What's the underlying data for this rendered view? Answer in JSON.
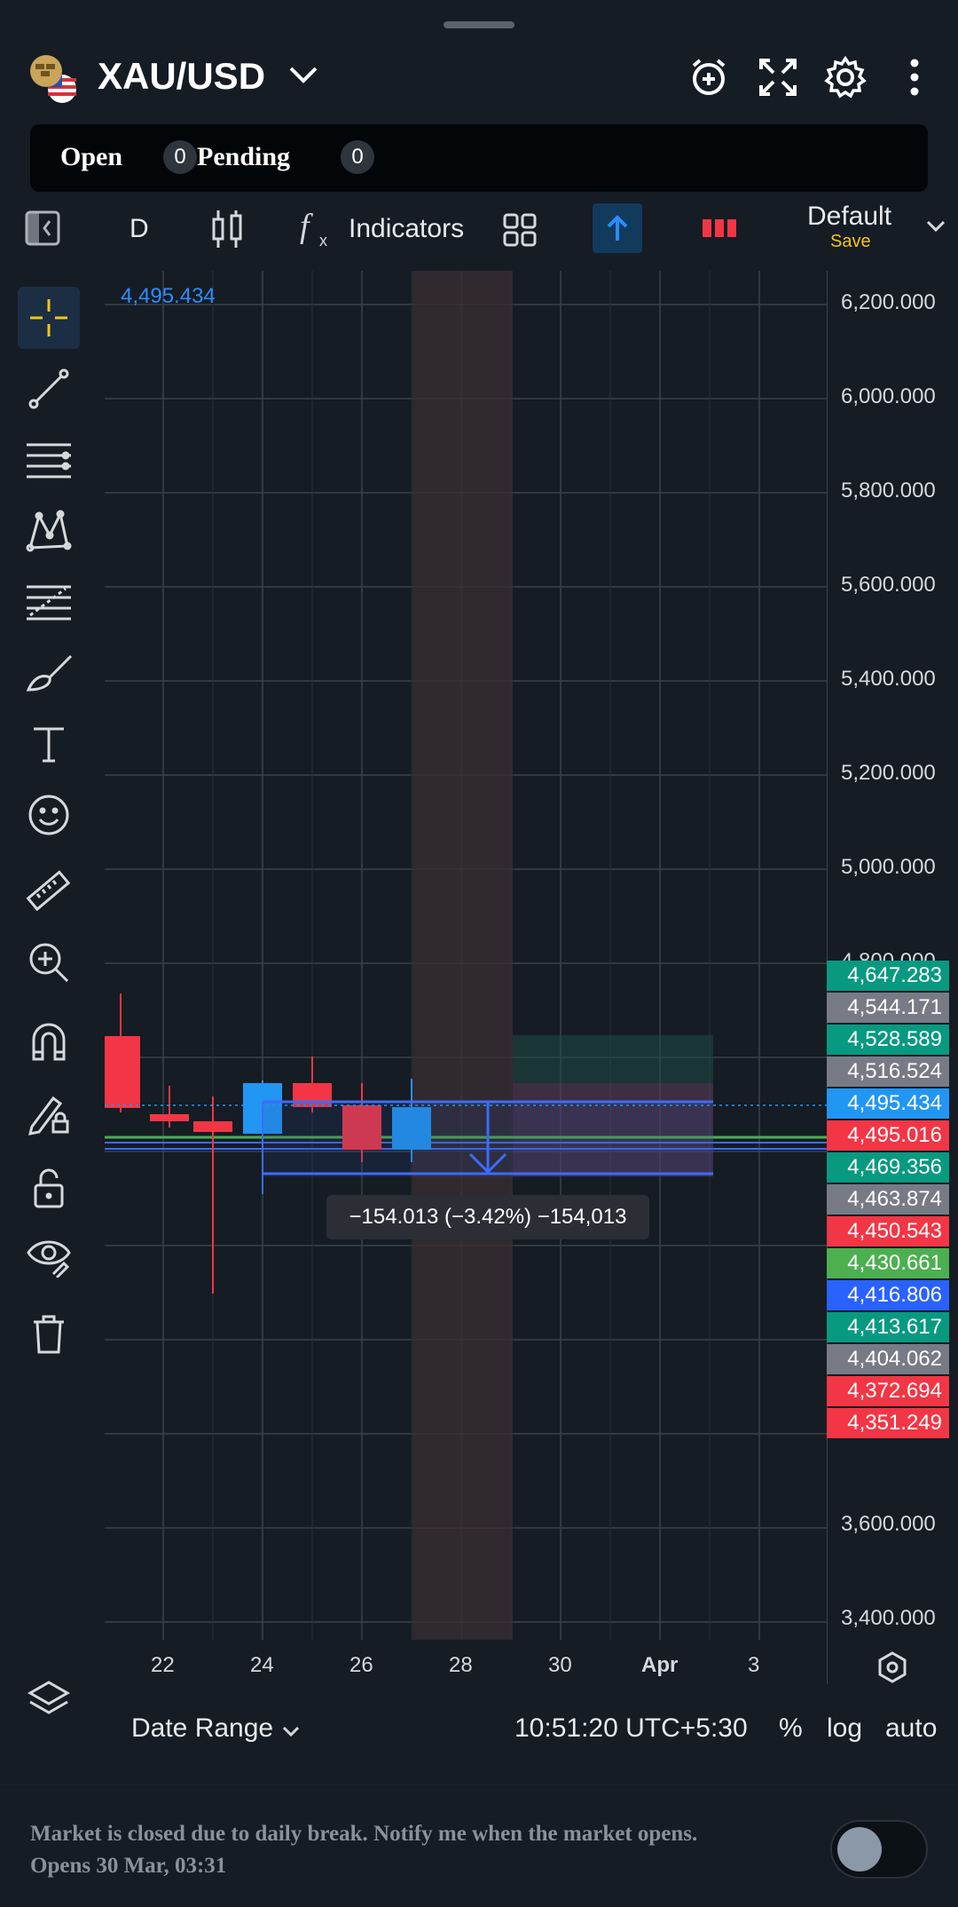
{
  "header": {
    "symbol": "XAU/USD"
  },
  "orders": {
    "open_label": "Open",
    "open_count": "0",
    "pending_label": "Pending",
    "pending_count": "0"
  },
  "toolbar": {
    "timeframe": "D",
    "indicators_label": "Indicators",
    "layout_label": "Default",
    "layout_save": "Save"
  },
  "chart": {
    "crosshair_price": "4,495.434",
    "measure_tooltip": "−154.013 (−3.42%) −154,013",
    "y_ticks": [
      "6,200.000",
      "6,000.000",
      "5,800.000",
      "5,600.000",
      "5,400.000",
      "5,200.000",
      "5,000.000",
      "4,800.000",
      "3,600.000",
      "3,400.000"
    ],
    "x_ticks": [
      "22",
      "24",
      "26",
      "28",
      "30",
      "Apr",
      "3"
    ],
    "price_tags": [
      {
        "value": "4,647.283",
        "color": "#089981"
      },
      {
        "value": "4,544.171",
        "color": "#787b86"
      },
      {
        "value": "4,528.589",
        "color": "#089981"
      },
      {
        "value": "4,516.524",
        "color": "#787b86"
      },
      {
        "value": "4,495.434",
        "color": "#2196f3"
      },
      {
        "value": "4,495.016",
        "color": "#f23645"
      },
      {
        "value": "4,469.356",
        "color": "#089981"
      },
      {
        "value": "4,463.874",
        "color": "#787b86"
      },
      {
        "value": "4,450.543",
        "color": "#f23645"
      },
      {
        "value": "4,430.661",
        "color": "#4caf50"
      },
      {
        "value": "4,416.806",
        "color": "#2962ff"
      },
      {
        "value": "4,413.617",
        "color": "#089981"
      },
      {
        "value": "4,404.062",
        "color": "#787b86"
      },
      {
        "value": "4,372.694",
        "color": "#f23645"
      },
      {
        "value": "4,351.249",
        "color": "#f23645"
      }
    ]
  },
  "bottom": {
    "date_range_label": "Date Range",
    "time": "10:51:20 UTC+5:30",
    "percent": "%",
    "log": "log",
    "auto": "auto"
  },
  "status": {
    "line1": "Market is closed due to daily break. Notify me when the market opens.",
    "line2": "Opens 30 Mar, 03:31"
  },
  "colors": {
    "background": "#151c24",
    "up_candle": "#2196f3",
    "down_candle": "#f23645",
    "accent_blue": "#2962ff"
  }
}
